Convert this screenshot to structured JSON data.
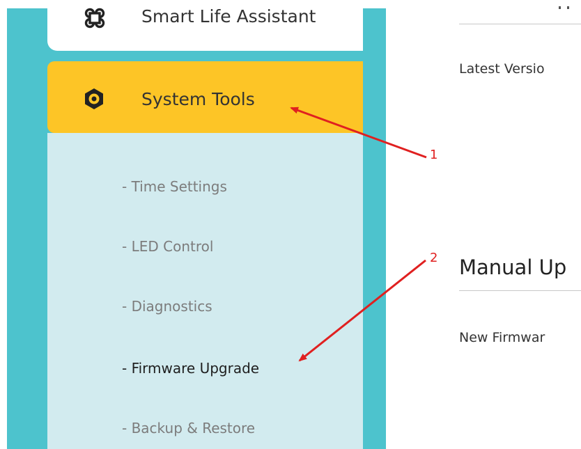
{
  "sidebar": {
    "smart_life": {
      "label": "Smart Life Assistant",
      "icon": "cmd-icon"
    },
    "system_tools": {
      "label": "System Tools",
      "icon": "gear-icon"
    },
    "submenu": [
      {
        "label": "- Time Settings"
      },
      {
        "label": "- LED Control"
      },
      {
        "label": "- Diagnostics"
      },
      {
        "label": "- Firmware Upgrade",
        "active": true
      },
      {
        "label": "- Backup & Restore"
      }
    ]
  },
  "main": {
    "latest_version_label": "Latest Versio",
    "manual_upgrade_title": "Manual Up",
    "new_firmware_label": "New Firmwar"
  },
  "annotations": {
    "label_1": "1",
    "label_2": "2",
    "color": "#e02020"
  },
  "colors": {
    "sidebar_teal": "#4dc3cd",
    "active_yellow": "#fdc526",
    "submenu_bg": "#d2ebef"
  }
}
